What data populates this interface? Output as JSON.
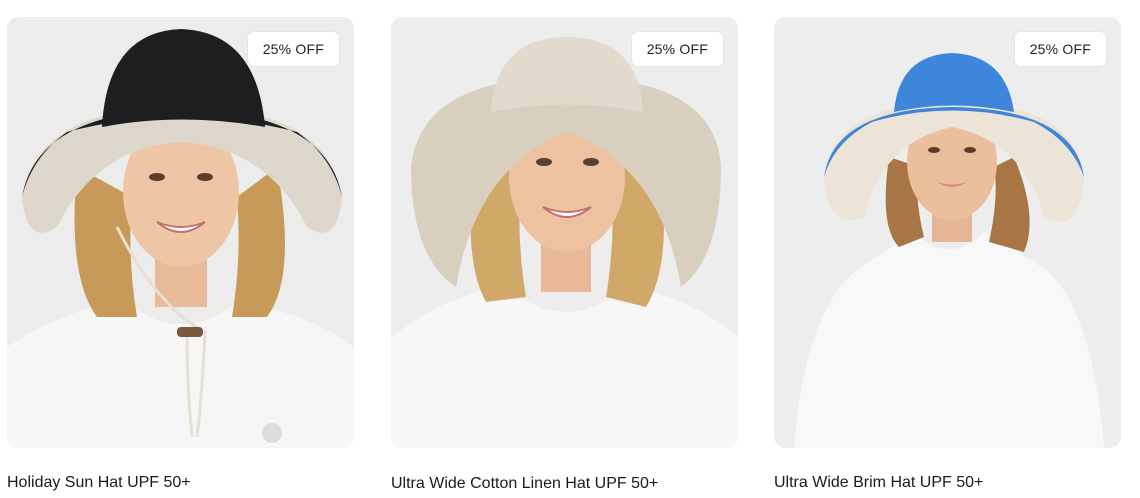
{
  "products": [
    {
      "name": "Holiday Sun Hat UPF 50+",
      "badge": "25% OFF",
      "hat_color": "#1e1e20",
      "hat_lining": "#ddd6cb"
    },
    {
      "name": "Ultra Wide Cotton Linen Hat UPF 50+",
      "badge": "25% OFF",
      "hat_color": "#e2dacd",
      "hat_lining": "#d4cab9"
    },
    {
      "name": "Ultra Wide Brim Hat UPF 50+",
      "badge": "25% OFF",
      "hat_color": "#3d86dc",
      "hat_lining": "#ece4d6"
    }
  ]
}
